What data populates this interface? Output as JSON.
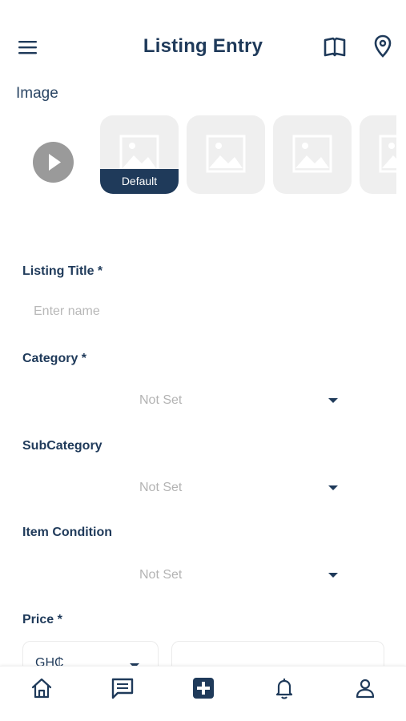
{
  "header": {
    "title": "Listing Entry",
    "icons": [
      "menu-icon",
      "book-icon",
      "location-pin-icon"
    ]
  },
  "image_section": {
    "label": "Image",
    "default_tag": "Default",
    "thumbnail_count": 4
  },
  "form": {
    "listing_title": {
      "label": "Listing Title *",
      "placeholder": "Enter name"
    },
    "category": {
      "label": "Category *",
      "value": "Not Set"
    },
    "subcategory": {
      "label": "SubCategory",
      "value": "Not Set"
    },
    "item_condition": {
      "label": "Item Condition",
      "value": "Not Set"
    },
    "price": {
      "label": "Price *",
      "currency": "GH₵"
    }
  },
  "bottom_nav": {
    "items": [
      "home-icon",
      "chat-icon",
      "add-listing-icon",
      "notifications-icon",
      "profile-icon"
    ],
    "active": "add-listing-icon"
  },
  "colors": {
    "primary": "#1f3a5a",
    "placeholder": "#b3b3b3",
    "thumbnail_bg": "#efefef",
    "play_button": "#9a9a9a"
  }
}
